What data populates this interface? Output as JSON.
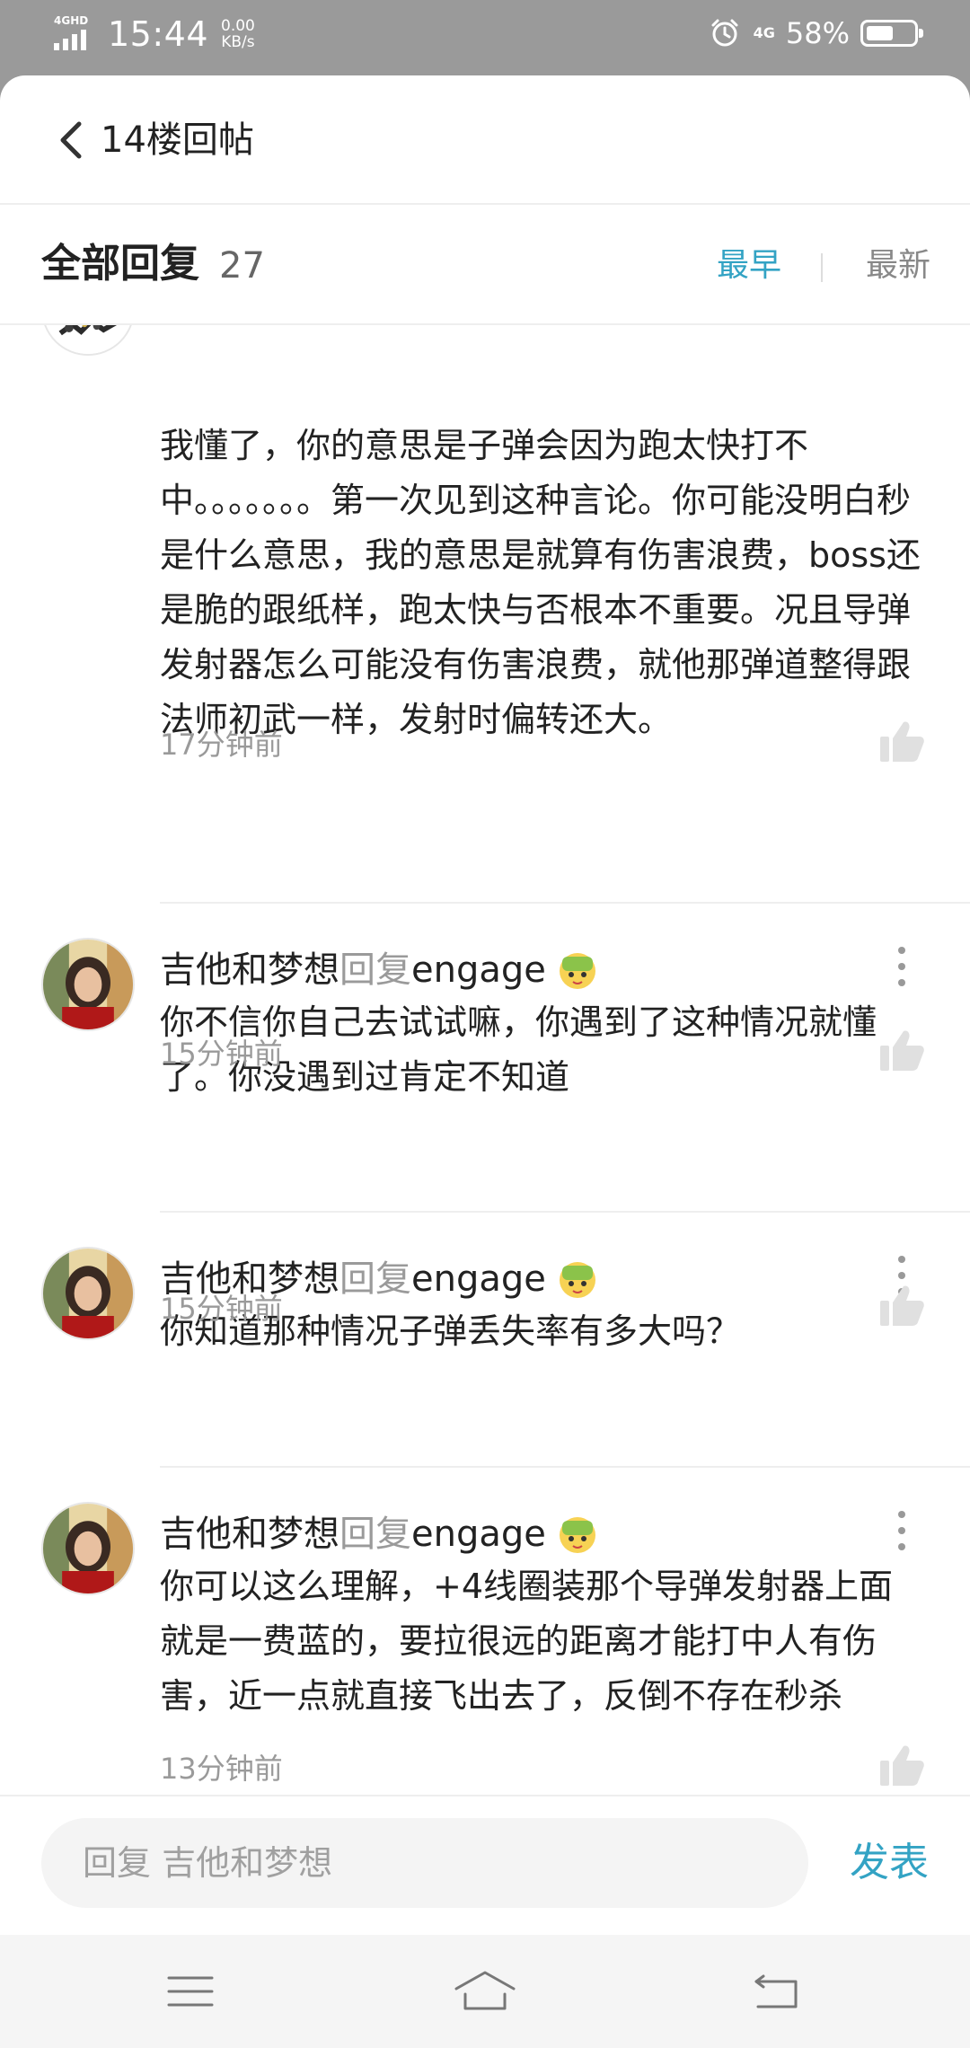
{
  "status_bar": {
    "network": "4GHD",
    "time": "15:44",
    "speed_value": "0.00",
    "speed_unit": "KB/s",
    "cellular": "4G",
    "battery_percent_text": "58%",
    "battery_level": 0.58
  },
  "header": {
    "title": "14楼回帖"
  },
  "filter": {
    "title": "全部回复",
    "count": "27",
    "sort_earliest": "最早",
    "sort_latest": "最新"
  },
  "comments": [
    {
      "body": "我懂了，你的意思是子弹会因为跑太快打不中。。。。。。。第一次见到这种言论。你可能没明白秒是什么意思，我的意思是就算有伤害浪费，boss还是脆的跟纸样，跑太快与否根本不重要。况且导弹发射器怎么可能没有伤害浪费，就他那弹道整得跟法师初武一样，发射时偏转还大。",
      "time": "17分钟前"
    },
    {
      "author": "吉他和梦想",
      "reply_word": "回复",
      "target": "engage",
      "body": "你不信你自己去试试嘛，你遇到了这种情况就懂了。你没遇到过肯定不知道",
      "time": "15分钟前"
    },
    {
      "author": "吉他和梦想",
      "reply_word": "回复",
      "target": "engage",
      "body": "你知道那种情况子弹丢失率有多大吗？",
      "time": "15分钟前"
    },
    {
      "author": "吉他和梦想",
      "reply_word": "回复",
      "target": "engage",
      "body": "你可以这么理解，+4线圈装那个导弹发射器上面就是一费蓝的，要拉很远的距离才能打中人有伤害，近一点就直接飞出去了，反倒不存在秒杀",
      "time": "13分钟前"
    }
  ],
  "reply_bar": {
    "placeholder": "回复 吉他和梦想",
    "send_label": "发表"
  },
  "colors": {
    "accent": "#33a3c4",
    "muted": "#9a9a9a",
    "status_bar_bg": "#9a9a9a"
  },
  "icons": {
    "back": "chevron-left-icon",
    "like": "thumbs-up-icon",
    "more": "more-vertical-icon",
    "nav_menu": "menu-icon",
    "nav_home": "home-icon",
    "nav_back": "back-arrow-icon"
  }
}
